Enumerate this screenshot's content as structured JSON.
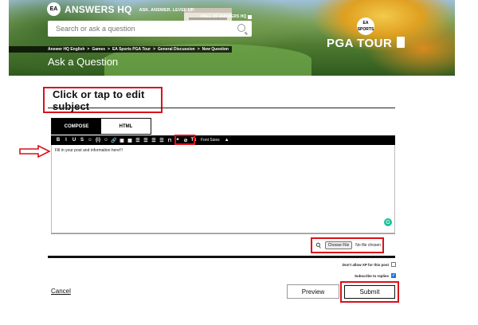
{
  "header": {
    "brand_logo": "EA",
    "brand_name": "ANSWERS HQ",
    "brand_tagline": "ASK. ANSWER. LEVEL UP.",
    "hall_of_answers": "HALL OF ANSWERS HQ",
    "search_placeholder": "Search or ask a question",
    "game_badge": "EA SPORTS",
    "game_title": "PGA TOUR",
    "breadcrumb": [
      "Answer HQ English",
      ">",
      "Games",
      ">",
      "EA Sports PGA Tour",
      ">",
      "General Discussion",
      ">",
      "New Question"
    ],
    "page_title": "Ask a Question"
  },
  "form": {
    "subject_placeholder": "Click or tap to edit subject",
    "tabs": [
      "COMPOSE",
      "HTML"
    ],
    "toolbar": [
      "B",
      "I",
      "U",
      "S",
      "☺",
      "{i}",
      "☺",
      "🔗",
      "▣",
      "▦",
      "☰",
      "☰",
      "☰",
      "☰",
      "⊓",
      "❝",
      "⊘",
      "Tx",
      "▲"
    ],
    "font_sizes_label": "Font Sizes",
    "editor_placeholder": "Fill in your post and information here!!!",
    "choose_file_label": "Choose File",
    "file_status": "No file chosen",
    "option_no_xp": "Don't allow XP for this post",
    "option_subscribe": "Subscribe to replies",
    "cancel_label": "Cancel",
    "preview_label": "Preview",
    "submit_label": "Submit"
  },
  "colors": {
    "highlight": "#d9111b",
    "toolbar": "#000000",
    "checkbox_checked": "#1a73e8"
  }
}
